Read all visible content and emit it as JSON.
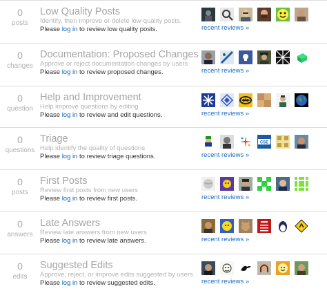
{
  "queues": [
    {
      "count": "0",
      "unit": "posts",
      "title": "Low Quality Posts",
      "description": "Identify, then improve or delete low-quality posts.",
      "action_prefix": "Please ",
      "login_label": "log in",
      "action_suffix": " to review low quality posts.",
      "recent_label": "recent reviews »",
      "avatars": [
        "avatar-dark-figure",
        "avatar-magnifier",
        "avatar-man-glasses",
        "avatar-man-beard",
        "avatar-green-smiley",
        "avatar-man-portrait"
      ]
    },
    {
      "count": "0",
      "unit": "changes",
      "title": "Documentation: Proposed Changes",
      "description": "Approve or reject documentation changes by users",
      "action_prefix": "Please ",
      "login_label": "log in",
      "action_suffix": " to review proposed changes.",
      "recent_label": "recent reviews »",
      "avatars": [
        "avatar-man-dark",
        "avatar-blue-diagonal",
        "avatar-skull-flag",
        "avatar-man-hat",
        "avatar-black-pattern",
        "avatar-green-cube"
      ]
    },
    {
      "count": "0",
      "unit": "question",
      "title": "Help and Improvement",
      "description": "Help improve questions by editing",
      "action_prefix": "Please ",
      "login_label": "log in",
      "action_suffix": " to review and edit questions.",
      "recent_label": "recent reviews »",
      "avatars": [
        "avatar-blue-snowflake",
        "avatar-geometric-blue",
        "avatar-batman",
        "avatar-tan-pattern",
        "avatar-man-white",
        "avatar-earth"
      ]
    },
    {
      "count": "0",
      "unit": "questions",
      "title": "Triage",
      "description": "Help identify the quality of questions",
      "action_prefix": "Please ",
      "login_label": "log in",
      "action_suffix": " to review triage questions.",
      "recent_label": "recent reviews »",
      "avatars": [
        "avatar-luigi",
        "avatar-bw-portrait",
        "avatar-color-sparkle",
        "avatar-cse",
        "avatar-yellow-pattern",
        "avatar-man-smile"
      ]
    },
    {
      "count": "0",
      "unit": "posts",
      "title": "First Posts",
      "description": "Review first posts from new users",
      "action_prefix": "Please ",
      "login_label": "log in",
      "action_suffix": " to review first posts.",
      "recent_label": "recent reviews »",
      "avatars": [
        "avatar-white-ball",
        "avatar-purple-cartoon",
        "avatar-man-dark-hair",
        "avatar-green-tiles",
        "avatar-man-light",
        "avatar-green-pattern"
      ]
    },
    {
      "count": "0",
      "unit": "answers",
      "title": "Late Answers",
      "description": "Review late answers from new users",
      "action_prefix": "Please ",
      "login_label": "log in",
      "action_suffix": " to review late answers.",
      "recent_label": "recent reviews »",
      "avatars": [
        "avatar-man-tan",
        "avatar-yellow-cartoon",
        "avatar-cat",
        "avatar-keep-calm",
        "avatar-penguin",
        "avatar-warning-sign"
      ]
    },
    {
      "count": "0",
      "unit": "edits",
      "title": "Suggested Edits",
      "description": "Approve, reject, or improve edits suggested by users",
      "action_prefix": "Please ",
      "login_label": "log in",
      "action_suffix": " to review suggested edits.",
      "recent_label": "recent reviews »",
      "avatars": [
        "avatar-man-photo",
        "avatar-sketch-face",
        "avatar-black-bird",
        "avatar-woman-brown",
        "avatar-orange-cartoon",
        "avatar-man-outdoors"
      ]
    }
  ]
}
